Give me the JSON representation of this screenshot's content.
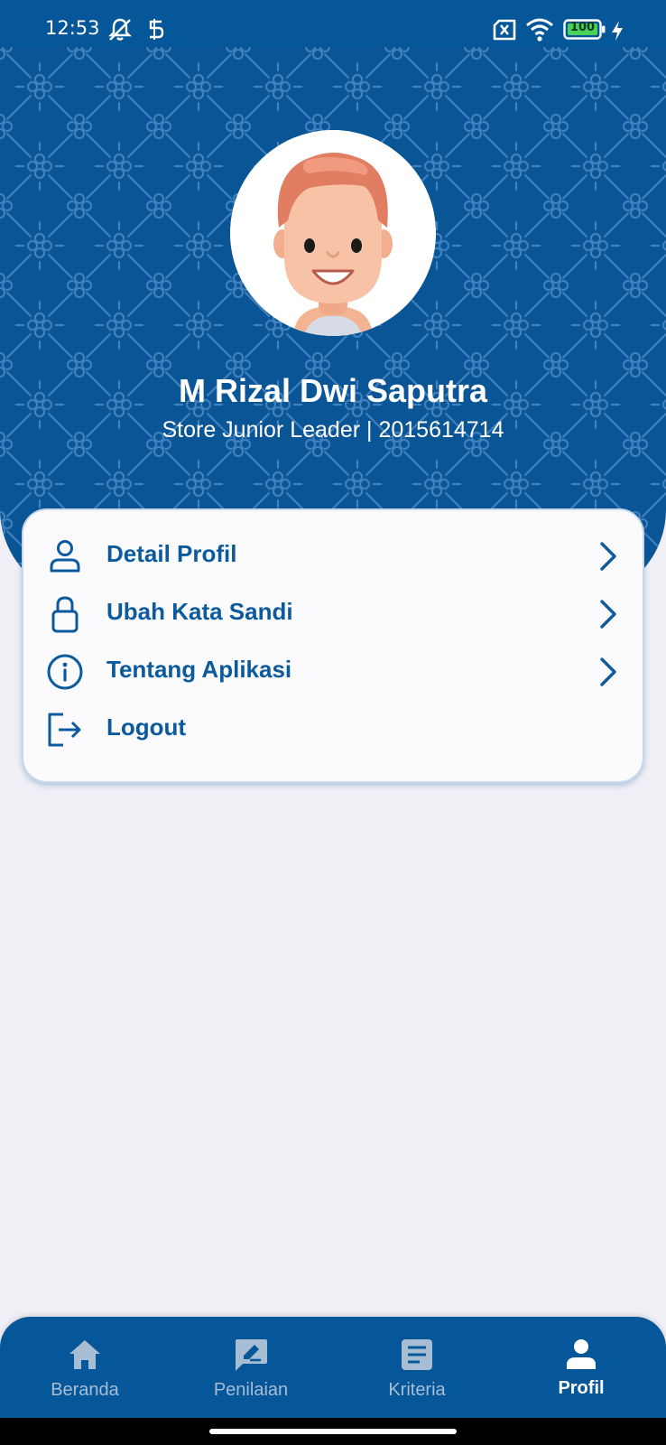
{
  "status_bar": {
    "time": "12:53",
    "battery": "100",
    "icons": [
      "do-not-disturb-icon",
      "app-notification-icon",
      "sim-error-icon",
      "wifi-icon",
      "battery-icon",
      "charging-icon"
    ]
  },
  "profile": {
    "name": "M Rizal Dwi Saputra",
    "subtitle": "Store Junior Leader | 2015614714"
  },
  "menu": {
    "items": [
      {
        "label": "Detail Profil",
        "icon": "person-icon",
        "has_chevron": true
      },
      {
        "label": "Ubah Kata Sandi",
        "icon": "lock-icon",
        "has_chevron": true
      },
      {
        "label": "Tentang Aplikasi",
        "icon": "info-icon",
        "has_chevron": true
      },
      {
        "label": "Logout",
        "icon": "logout-icon",
        "has_chevron": false
      }
    ]
  },
  "bottom_nav": {
    "items": [
      {
        "label": "Beranda",
        "icon": "home-icon",
        "active": false
      },
      {
        "label": "Penilaian",
        "icon": "edit-note-icon",
        "active": false
      },
      {
        "label": "Kriteria",
        "icon": "article-icon",
        "active": false
      },
      {
        "label": "Profil",
        "icon": "person-filled-icon",
        "active": true
      }
    ]
  },
  "colors": {
    "primary": "#06579a",
    "header": "#0a5596",
    "menu_text": "#0c5a9e",
    "background": "#efeff5",
    "nav_inactive": "#a7bdd4",
    "nav_active": "#ffffff"
  }
}
